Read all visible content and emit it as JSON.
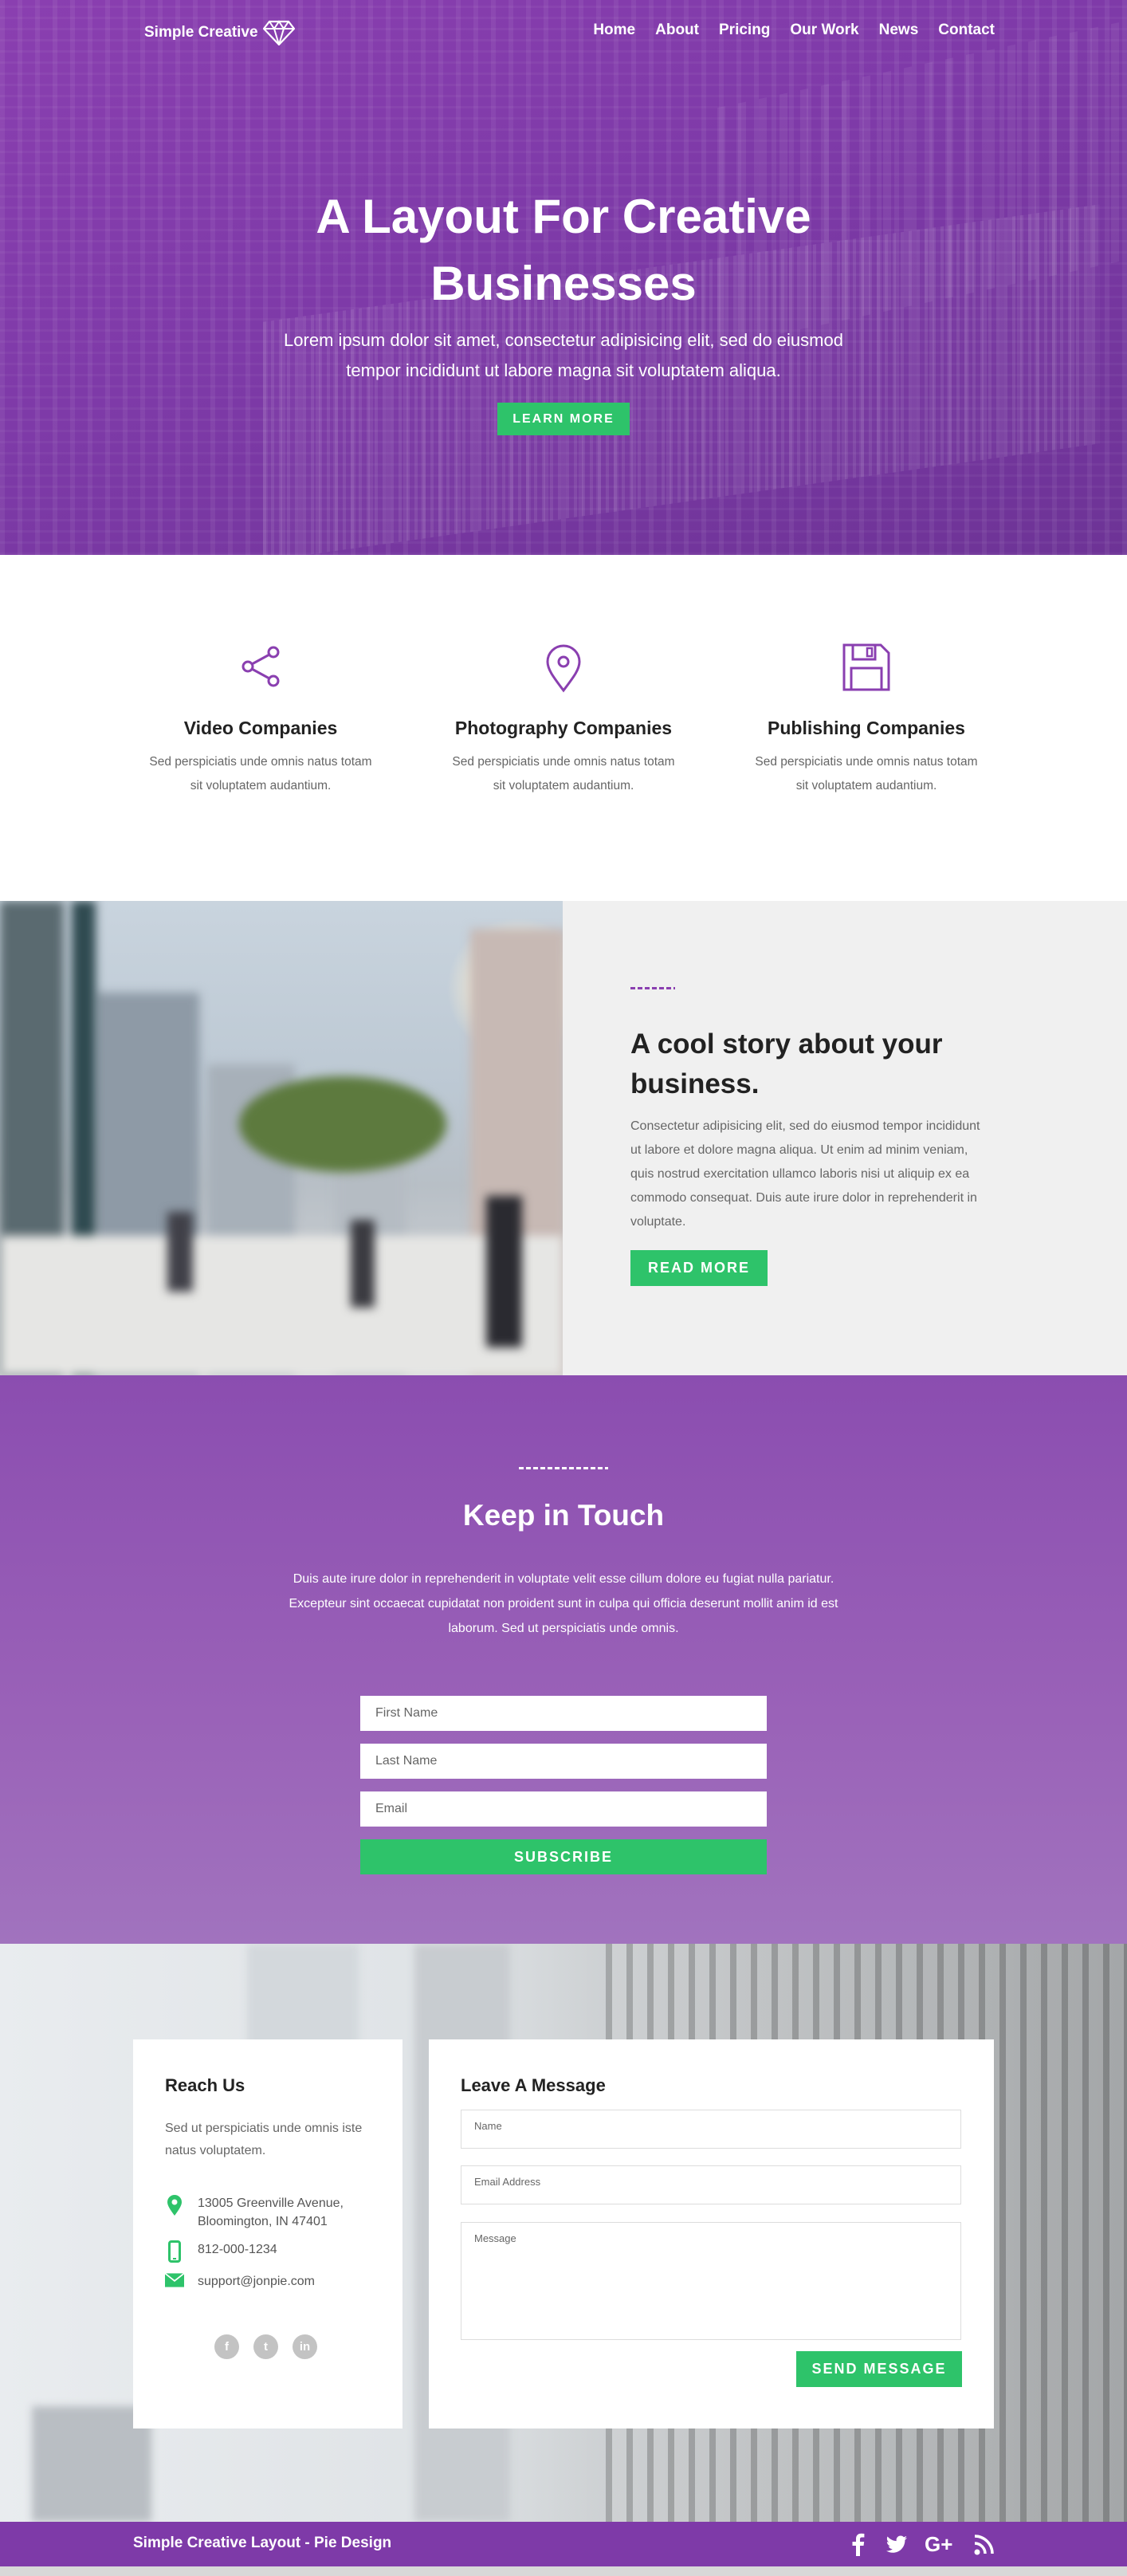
{
  "brand": {
    "name": "Simple Creative",
    "logo_icon": "diamond-icon"
  },
  "nav": {
    "items": [
      "Home",
      "About",
      "Pricing",
      "Our Work",
      "News",
      "Contact"
    ]
  },
  "hero": {
    "title_line1": "A Layout For Creative",
    "title_line2": "Businesses",
    "subtitle_line1": "Lorem ipsum dolor sit amet, consectetur adipisicing elit, sed do eiusmod",
    "subtitle_line2": "tempor incididunt ut labore magna sit voluptatem aliqua.",
    "button": "LEARN MORE"
  },
  "features": [
    {
      "icon": "share-icon",
      "title": "Video Companies",
      "text_line1": "Sed perspiciatis unde omnis natus totam",
      "text_line2": "sit voluptatem audantium."
    },
    {
      "icon": "location-pin-icon",
      "title": "Photography Companies",
      "text_line1": "Sed perspiciatis unde omnis natus totam",
      "text_line2": "sit voluptatem audantium."
    },
    {
      "icon": "floppy-disk-icon",
      "title": "Publishing Companies",
      "text_line1": "Sed perspiciatis unde omnis natus totam",
      "text_line2": "sit voluptatem audantium."
    }
  ],
  "story": {
    "title": "A cool story about your business.",
    "text": "Consectetur adipisicing elit, sed do eiusmod tempor incididunt ut labore et dolore magna aliqua. Ut enim ad minim veniam, quis nostrud exercitation ullamco laboris nisi ut aliquip ex ea commodo consequat. Duis aute irure dolor in reprehenderit in voluptate.",
    "button": "READ MORE"
  },
  "keep_in_touch": {
    "title": "Keep in Touch",
    "text": "Duis aute irure dolor in reprehenderit in voluptate velit esse cillum dolore eu fugiat nulla pariatur. Excepteur sint occaecat cupidatat non proident sunt in culpa qui officia deserunt mollit anim id est laborum. Sed ut perspiciatis unde omnis.",
    "first_name_placeholder": "First Name",
    "last_name_placeholder": "Last Name",
    "email_placeholder": "Email",
    "button": "SUBSCRIBE"
  },
  "reach_us": {
    "title": "Reach Us",
    "text": "Sed ut perspiciatis unde omnis iste natus voluptatem.",
    "address_line1": "13005 Greenville Avenue,",
    "address_line2": "Bloomington, IN 47401",
    "phone": "812-000-1234",
    "email": "support@jonpie.com",
    "socials": [
      "f",
      "t",
      "in"
    ]
  },
  "message_form": {
    "title": "Leave A Message",
    "name_placeholder": "Name",
    "email_placeholder": "Email Address",
    "message_placeholder": "Message",
    "button": "SEND MESSAGE"
  },
  "footer": {
    "text": "Simple Creative Layout - Pie Design"
  },
  "colors": {
    "purple": "#8a3fb0",
    "green": "#2ec36a",
    "footer": "#7e3aa8"
  }
}
